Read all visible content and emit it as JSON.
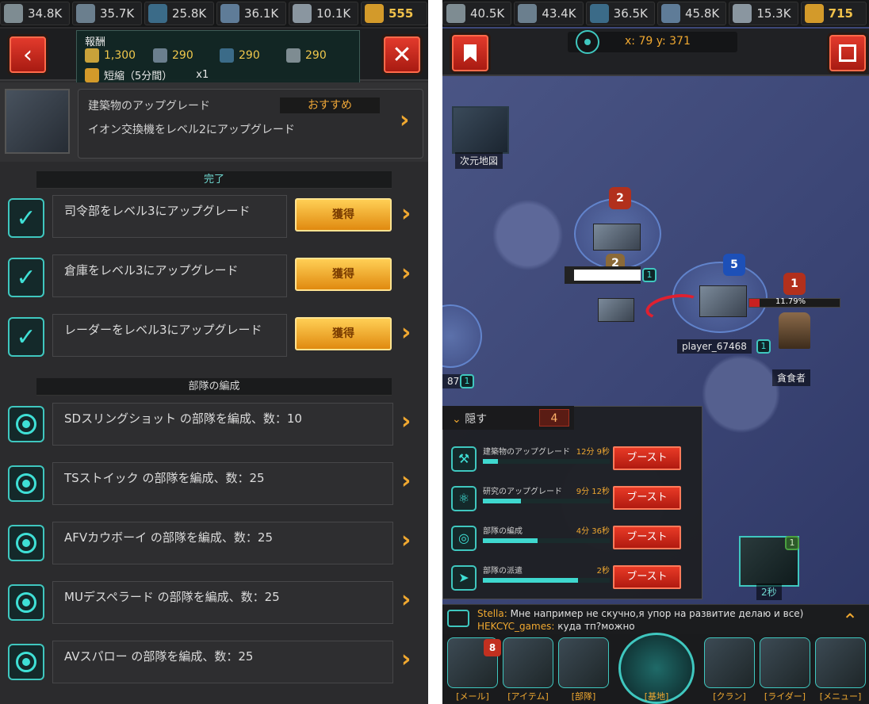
{
  "left": {
    "resources": [
      {
        "icon": "missile-icon",
        "value": "34.8K"
      },
      {
        "icon": "fuel-barrel-icon",
        "value": "35.7K"
      },
      {
        "icon": "supply-crate-icon",
        "value": "25.8K"
      },
      {
        "icon": "canister-icon",
        "value": "36.1K"
      },
      {
        "icon": "ore-icon",
        "value": "10.1K"
      },
      {
        "icon": "gold-bars-icon",
        "value": "555"
      }
    ],
    "reward": {
      "title": "報酬",
      "items": [
        {
          "icon": "coin-icon",
          "value": "1,300"
        },
        {
          "icon": "fuel-barrel-icon",
          "value": "290"
        },
        {
          "icon": "supply-crate-icon",
          "value": "290"
        },
        {
          "icon": "missile-icon",
          "value": "290"
        }
      ],
      "speedup_label": "短縮（5分間）",
      "speedup_qty": "x1"
    },
    "recommended": {
      "title": "建築物のアップグレード",
      "badge": "おすすめ",
      "desc": "イオン交換機をレベル2にアップグレード"
    },
    "section_done": "完了",
    "done_quests": [
      {
        "text": "司令部をレベル3にアップグレード",
        "button": "獲得"
      },
      {
        "text": "倉庫をレベル3にアップグレード",
        "button": "獲得"
      },
      {
        "text": "レーダーをレベル3にアップグレード",
        "button": "獲得"
      }
    ],
    "section_troops": "部隊の編成",
    "troop_quests": [
      {
        "text": "SDスリングショット の部隊を編成、数：10"
      },
      {
        "text": "TSストイック の部隊を編成、数：25"
      },
      {
        "text": "AFVカウボーイ の部隊を編成、数：25"
      },
      {
        "text": "MUデスペラード の部隊を編成、数：25"
      },
      {
        "text": "AVスパロー の部隊を編成、数：25"
      }
    ]
  },
  "right": {
    "resources": [
      {
        "icon": "missile-icon",
        "value": "40.5K"
      },
      {
        "icon": "fuel-barrel-icon",
        "value": "43.4K"
      },
      {
        "icon": "supply-crate-icon",
        "value": "36.5K"
      },
      {
        "icon": "canister-icon",
        "value": "45.8K"
      },
      {
        "icon": "ore-icon",
        "value": "15.3K"
      },
      {
        "icon": "gold-bars-icon",
        "value": "715"
      }
    ],
    "coords": "x: 79 y: 371",
    "map": {
      "dimension_map_label": "次元地図",
      "markers": [
        {
          "kind": "hex-red",
          "text": "2"
        },
        {
          "kind": "hex-bronze",
          "text": "2"
        },
        {
          "kind": "hex-blue",
          "text": "5"
        },
        {
          "kind": "hex-red",
          "text": "1"
        }
      ],
      "player_name": "player_67468",
      "player_level": "1",
      "base_level": "1",
      "enemy_progress_pct": 11.79,
      "enemy_progress_text": "11.79%",
      "enemy_name": "貪食者",
      "edge_label_partial": "87",
      "edge_level": "1",
      "building_timer_level": "1",
      "building_timer": "2秒"
    },
    "queue": {
      "hide_label": "隠す",
      "count": "4",
      "items": [
        {
          "icon": "tools-icon",
          "label": "建築物のアップグレード",
          "time": "12分 9秒",
          "progress": 0.12,
          "button": "ブースト"
        },
        {
          "icon": "atom-icon",
          "label": "研究のアップグレード",
          "time": "9分 12秒",
          "progress": 0.3,
          "button": "ブースト"
        },
        {
          "icon": "target-icon",
          "label": "部隊の編成",
          "time": "4分 36秒",
          "progress": 0.43,
          "button": "ブースト"
        },
        {
          "icon": "dispatch-icon",
          "label": "部隊の派遣",
          "time": "2秒",
          "progress": 0.75,
          "button": "ブースト"
        }
      ]
    },
    "chat": [
      {
        "name": "Stella:",
        "msg": "Мне например не скучно,я упор на развитие делаю и все)"
      },
      {
        "name": "HEKCYC_games:",
        "msg": "куда тп?можно"
      }
    ],
    "dock": {
      "mail_badge": "8",
      "items": [
        {
          "label": "[メール]",
          "icon": "mail-icon"
        },
        {
          "label": "[アイテム]",
          "icon": "items-icon"
        },
        {
          "label": "[部隊]",
          "icon": "troops-icon"
        },
        {
          "label": "[基地]",
          "icon": "base-icon"
        },
        {
          "label": "[クラン]",
          "icon": "clan-icon"
        },
        {
          "label": "[ライダー]",
          "icon": "radar-icon"
        },
        {
          "label": "[メニュー]",
          "icon": "menu-icon"
        }
      ]
    }
  }
}
